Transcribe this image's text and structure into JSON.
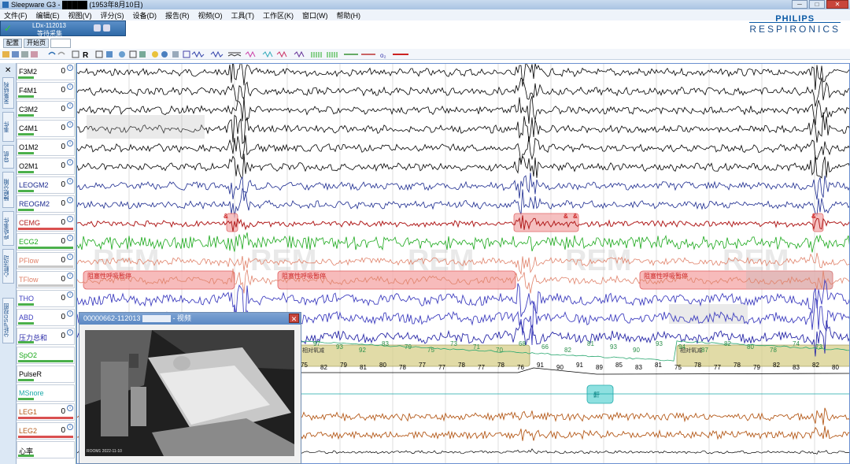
{
  "window": {
    "title": "Sleepware G3 - █████ (1953年8月10日)",
    "controls": [
      "─",
      "□",
      "✕"
    ]
  },
  "menu": [
    "文件(F)",
    "编辑(E)",
    "视图(V)",
    "评分(S)",
    "设备(D)",
    "报告(R)",
    "视频(O)",
    "工具(T)",
    "工作区(K)",
    "窗口(W)",
    "帮助(H)"
  ],
  "patient": {
    "device_id": "LDx-112013",
    "status": "等待采集"
  },
  "brand": {
    "line1": "PHILIPS",
    "line2": "RESPIRONICS"
  },
  "tabs": [
    "配置",
    "开始页"
  ],
  "side_tabs": [
    "采集结构",
    "事件",
    "导航",
    "睡眠分期",
    "呼吸事件",
    "心脏活动",
    "分析PSG视图"
  ],
  "channels": [
    {
      "name": "F3M2",
      "value": "0",
      "color": "#000000"
    },
    {
      "name": "F4M1",
      "value": "0",
      "color": "#000000"
    },
    {
      "name": "C3M2",
      "value": "0",
      "color": "#000000"
    },
    {
      "name": "C4M1",
      "value": "0",
      "color": "#000000"
    },
    {
      "name": "O1M2",
      "value": "0",
      "color": "#000000"
    },
    {
      "name": "O2M1",
      "value": "0",
      "color": "#000000"
    },
    {
      "name": "LEOGM2",
      "value": "0",
      "color": "#1b2a8f"
    },
    {
      "name": "REOGM2",
      "value": "0",
      "color": "#1b2a8f"
    },
    {
      "name": "CEMG",
      "value": "0",
      "color": "#b11c1c"
    },
    {
      "name": "ECG2",
      "value": "0",
      "color": "#1aa81a"
    },
    {
      "name": "PFlow",
      "value": "0",
      "color": "#e0826a"
    },
    {
      "name": "TFlow",
      "value": "0",
      "color": "#e0826a"
    },
    {
      "name": "THO",
      "value": "0",
      "color": "#4040c0"
    },
    {
      "name": "ABD",
      "value": "0",
      "color": "#4040c0"
    },
    {
      "name": "压力总和",
      "value": "0",
      "color": "#2a2aa8"
    },
    {
      "name": "SpO2",
      "value": "",
      "color": "#1aa81a"
    },
    {
      "name": "PulseR",
      "value": "",
      "color": "#000000"
    },
    {
      "name": "MSnore",
      "value": "",
      "color": "#1aa8a8"
    },
    {
      "name": "LEG1",
      "value": "0",
      "color": "#b55a1a"
    },
    {
      "name": "LEG2",
      "value": "0",
      "color": "#b55a1a"
    },
    {
      "name": "心率",
      "value": "",
      "color": "#000000"
    }
  ],
  "events": {
    "apnea": [
      "阻塞性呼吸暂停",
      "阻塞性呼吸暂停",
      "阻塞性呼吸暂停"
    ],
    "desat": [
      "相对氧减",
      "相对氧减"
    ],
    "arousal_marker": "&",
    "snore_marker": "鼾",
    "watermark": "REM"
  },
  "spo2_values": [
    "97",
    "93",
    "92",
    "83",
    "79",
    "75",
    "73",
    "71",
    "70",
    "68",
    "66",
    "82",
    "81",
    "93",
    "90",
    "93",
    "94",
    "87",
    "82",
    "80",
    "78",
    "74",
    "73"
  ],
  "pulse_values": [
    "75",
    "82",
    "79",
    "81",
    "80",
    "78",
    "77",
    "77",
    "78",
    "77",
    "78",
    "76",
    "91",
    "90",
    "91",
    "89",
    "85",
    "83",
    "81",
    "75",
    "78",
    "77",
    "78",
    "79",
    "82",
    "83",
    "82",
    "80"
  ],
  "video": {
    "title_prefix": "00000662-112013",
    "title_suffix": "- 视频",
    "timestamp": "ROOM1 2022-11-10"
  },
  "colors": {
    "eeg": "#000000",
    "eog": "#1b2a8f",
    "emg": "#b11c1c",
    "ecg": "#1aa81a",
    "flow": "#e0826a",
    "effort": "#4040c0",
    "leg": "#b55a1a",
    "event_apnea": "#f6b0b0",
    "event_desat": "#d7d08a"
  }
}
